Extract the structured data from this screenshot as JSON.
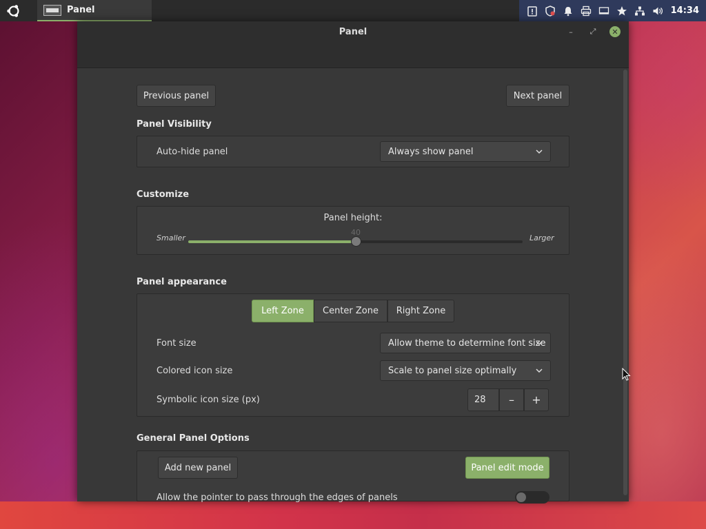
{
  "topbar": {
    "taskbar_item_label": "Panel",
    "clock": "14:34"
  },
  "window": {
    "title": "Panel",
    "buttons": {
      "minimize": "–",
      "maximize": "⤢",
      "close": "✕"
    }
  },
  "nav": {
    "previous": "Previous panel",
    "next": "Next panel"
  },
  "visibility": {
    "title": "Panel Visibility",
    "autohide_label": "Auto-hide panel",
    "autohide_value": "Always show panel"
  },
  "customize": {
    "title": "Customize",
    "height_label": "Panel height:",
    "height_value": "40",
    "height_fraction": 0.5,
    "smaller": "Smaller",
    "larger": "Larger"
  },
  "appearance": {
    "title": "Panel appearance",
    "zones": [
      "Left Zone",
      "Center Zone",
      "Right Zone"
    ],
    "active_zone": "Left Zone",
    "font_size_label": "Font size",
    "font_size_value": "Allow theme to determine font size",
    "colored_icon_label": "Colored icon size",
    "colored_icon_value": "Scale to panel size optimally",
    "symbolic_icon_label": "Symbolic icon size (px)",
    "symbolic_icon_value": "28",
    "minus": "–",
    "plus": "+"
  },
  "general": {
    "title": "General Panel Options",
    "add_panel": "Add new panel",
    "edit_mode": "Panel edit mode",
    "pointer_label": "Allow the pointer to pass through the edges of panels"
  },
  "colors": {
    "accent": "#8bb06a",
    "window_bg": "#383838",
    "box_bg": "#3c3c3c"
  }
}
